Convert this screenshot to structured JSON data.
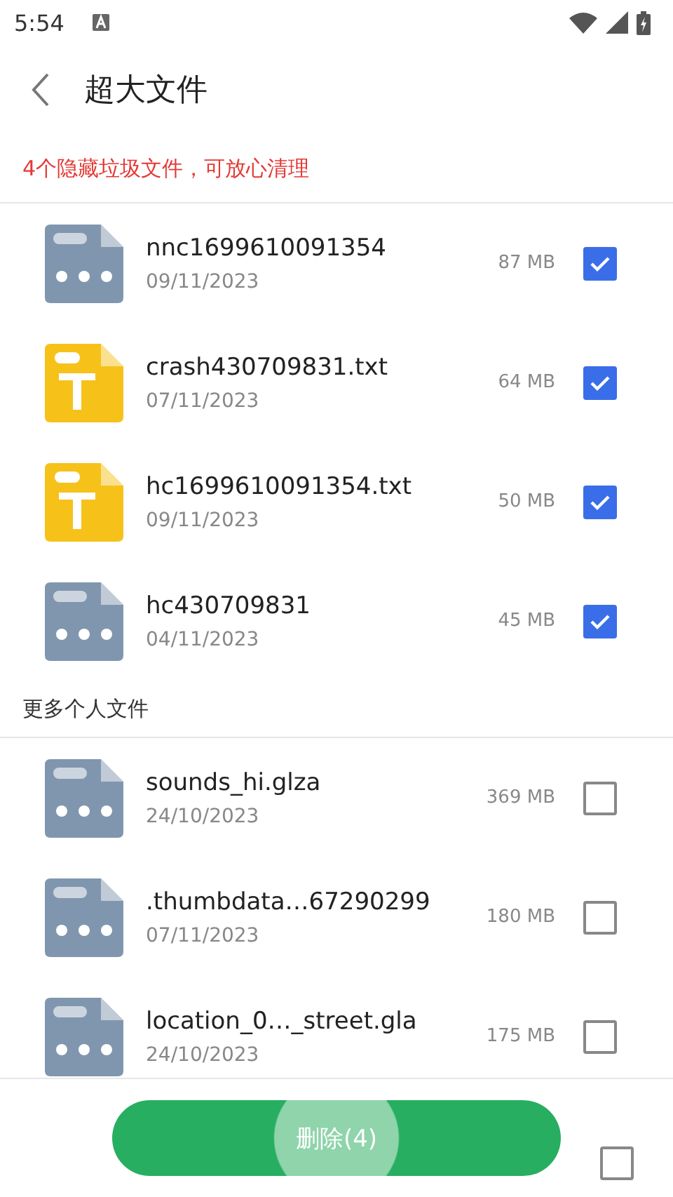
{
  "status_bar": {
    "time": "5:54"
  },
  "header": {
    "title": "超大文件"
  },
  "notice": "4个隐藏垃圾文件，可放心清理",
  "sections": [
    {
      "files": [
        {
          "kind": "other",
          "name": "nnc1699610091354",
          "date": "09/11/2023",
          "size": "87 MB",
          "checked": true
        },
        {
          "kind": "txt",
          "name": "crash430709831.txt",
          "date": "07/11/2023",
          "size": "64 MB",
          "checked": true
        },
        {
          "kind": "txt",
          "name": "hc1699610091354.txt",
          "date": "09/11/2023",
          "size": "50 MB",
          "checked": true
        },
        {
          "kind": "other",
          "name": "hc430709831",
          "date": "04/11/2023",
          "size": "45 MB",
          "checked": true
        }
      ]
    },
    {
      "label": "更多个人文件",
      "files": [
        {
          "kind": "other",
          "name": "sounds_hi.glza",
          "date": "24/10/2023",
          "size": "369 MB",
          "checked": false
        },
        {
          "kind": "other",
          "name": ".thumbdata…67290299",
          "date": "07/11/2023",
          "size": "180 MB",
          "checked": false
        },
        {
          "kind": "other",
          "name": "location_0…_street.gla",
          "date": "24/10/2023",
          "size": "175 MB",
          "checked": false
        }
      ]
    }
  ],
  "footer": {
    "button": "删除(4)",
    "select_all": {
      "checked": false
    }
  }
}
